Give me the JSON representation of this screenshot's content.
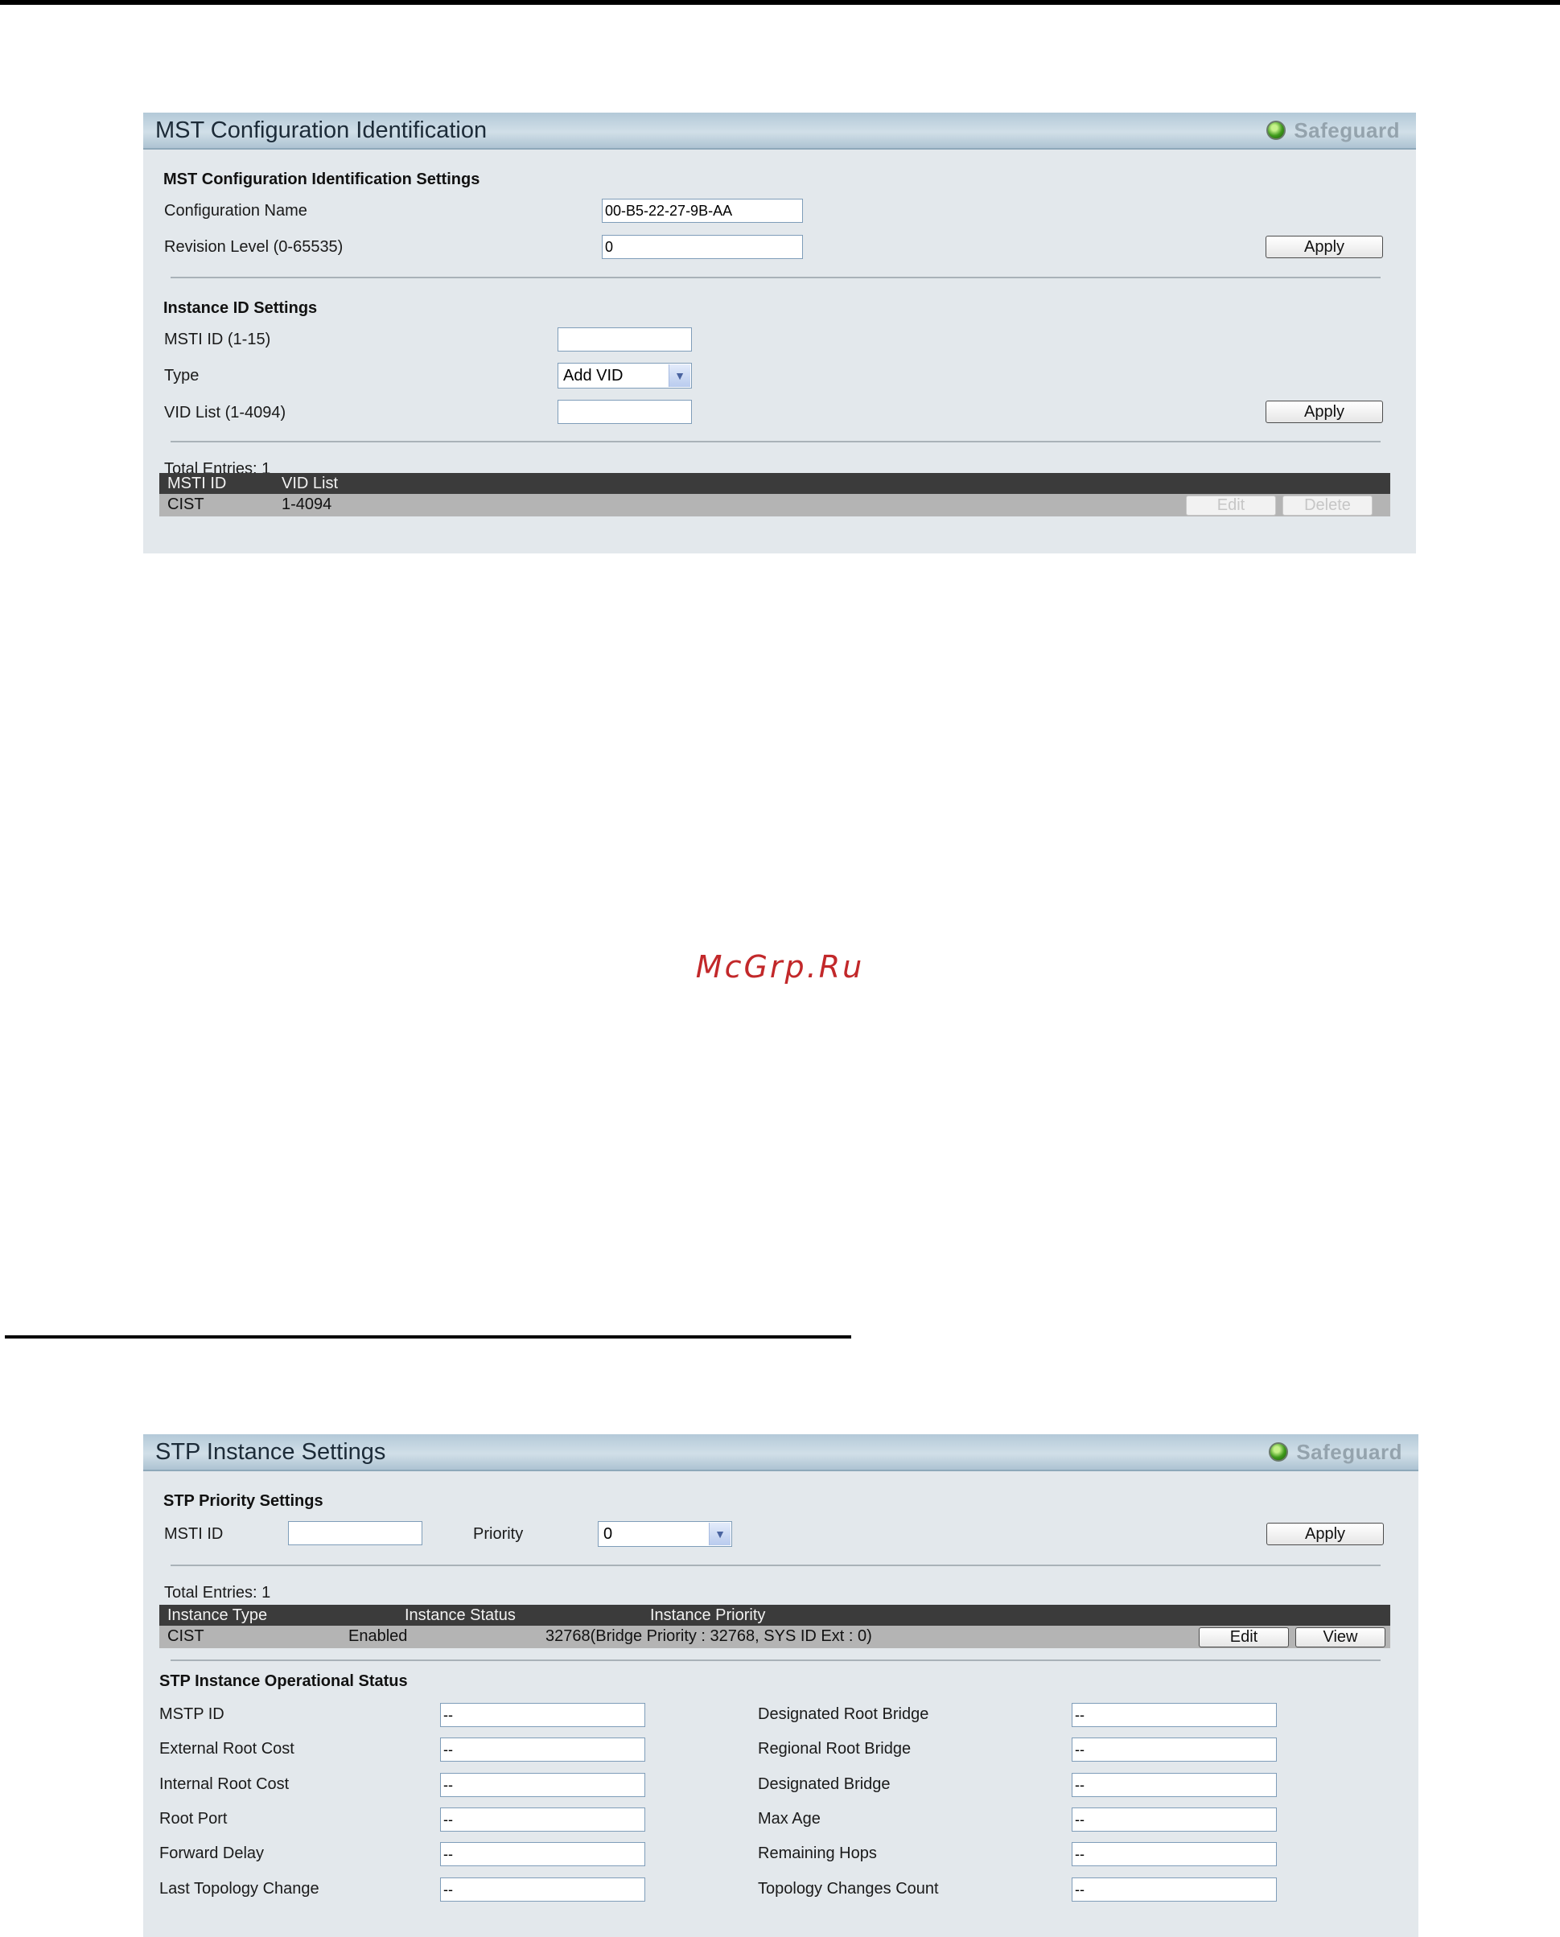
{
  "watermark": "McGrp.Ru",
  "mst_panel": {
    "title": "MST Configuration Identification",
    "safeguard_label": "Safeguard",
    "config_section": {
      "heading": "MST Configuration Identification Settings",
      "name_label": "Configuration Name",
      "name_value": "00-B5-22-27-9B-AA",
      "revision_label": "Revision Level (0-65535)",
      "revision_value": "0",
      "apply_label": "Apply"
    },
    "instance_section": {
      "heading": "Instance ID Settings",
      "msti_label": "MSTI ID (1-15)",
      "msti_value": "",
      "type_label": "Type",
      "type_selected": "Add VID",
      "vid_label": "VID List (1-4094)",
      "vid_value": "",
      "apply_label": "Apply"
    },
    "table": {
      "total_entries": "Total Entries: 1",
      "columns": [
        "MSTI ID",
        "VID List"
      ],
      "rows": [
        {
          "msti_id": "CIST",
          "vid_list": "1-4094",
          "edit_label": "Edit",
          "delete_label": "Delete"
        }
      ]
    }
  },
  "stp_panel": {
    "title": "STP Instance Settings",
    "safeguard_label": "Safeguard",
    "priority_section": {
      "heading": "STP Priority Settings",
      "msti_label": "MSTI ID",
      "msti_value": "",
      "priority_label": "Priority",
      "priority_selected": "0",
      "apply_label": "Apply"
    },
    "table": {
      "total_entries": "Total Entries: 1",
      "columns": [
        "Instance Type",
        "Instance Status",
        "Instance Priority"
      ],
      "rows": [
        {
          "type": "CIST",
          "status": "Enabled",
          "priority": "32768(Bridge Priority : 32768, SYS ID Ext : 0)",
          "edit_label": "Edit",
          "view_label": "View"
        }
      ]
    },
    "status_section": {
      "heading": "STP Instance Operational Status",
      "left": [
        {
          "label": "MSTP ID",
          "value": "--"
        },
        {
          "label": "External Root Cost",
          "value": "--"
        },
        {
          "label": "Internal Root Cost",
          "value": "--"
        },
        {
          "label": "Root Port",
          "value": "--"
        },
        {
          "label": "Forward Delay",
          "value": "--"
        },
        {
          "label": "Last Topology Change",
          "value": "--"
        }
      ],
      "right": [
        {
          "label": "Designated Root Bridge",
          "value": "--"
        },
        {
          "label": "Regional Root Bridge",
          "value": "--"
        },
        {
          "label": "Designated Bridge",
          "value": "--"
        },
        {
          "label": "Max Age",
          "value": "--"
        },
        {
          "label": "Remaining Hops",
          "value": "--"
        },
        {
          "label": "Topology Changes Count",
          "value": "--"
        }
      ]
    }
  }
}
